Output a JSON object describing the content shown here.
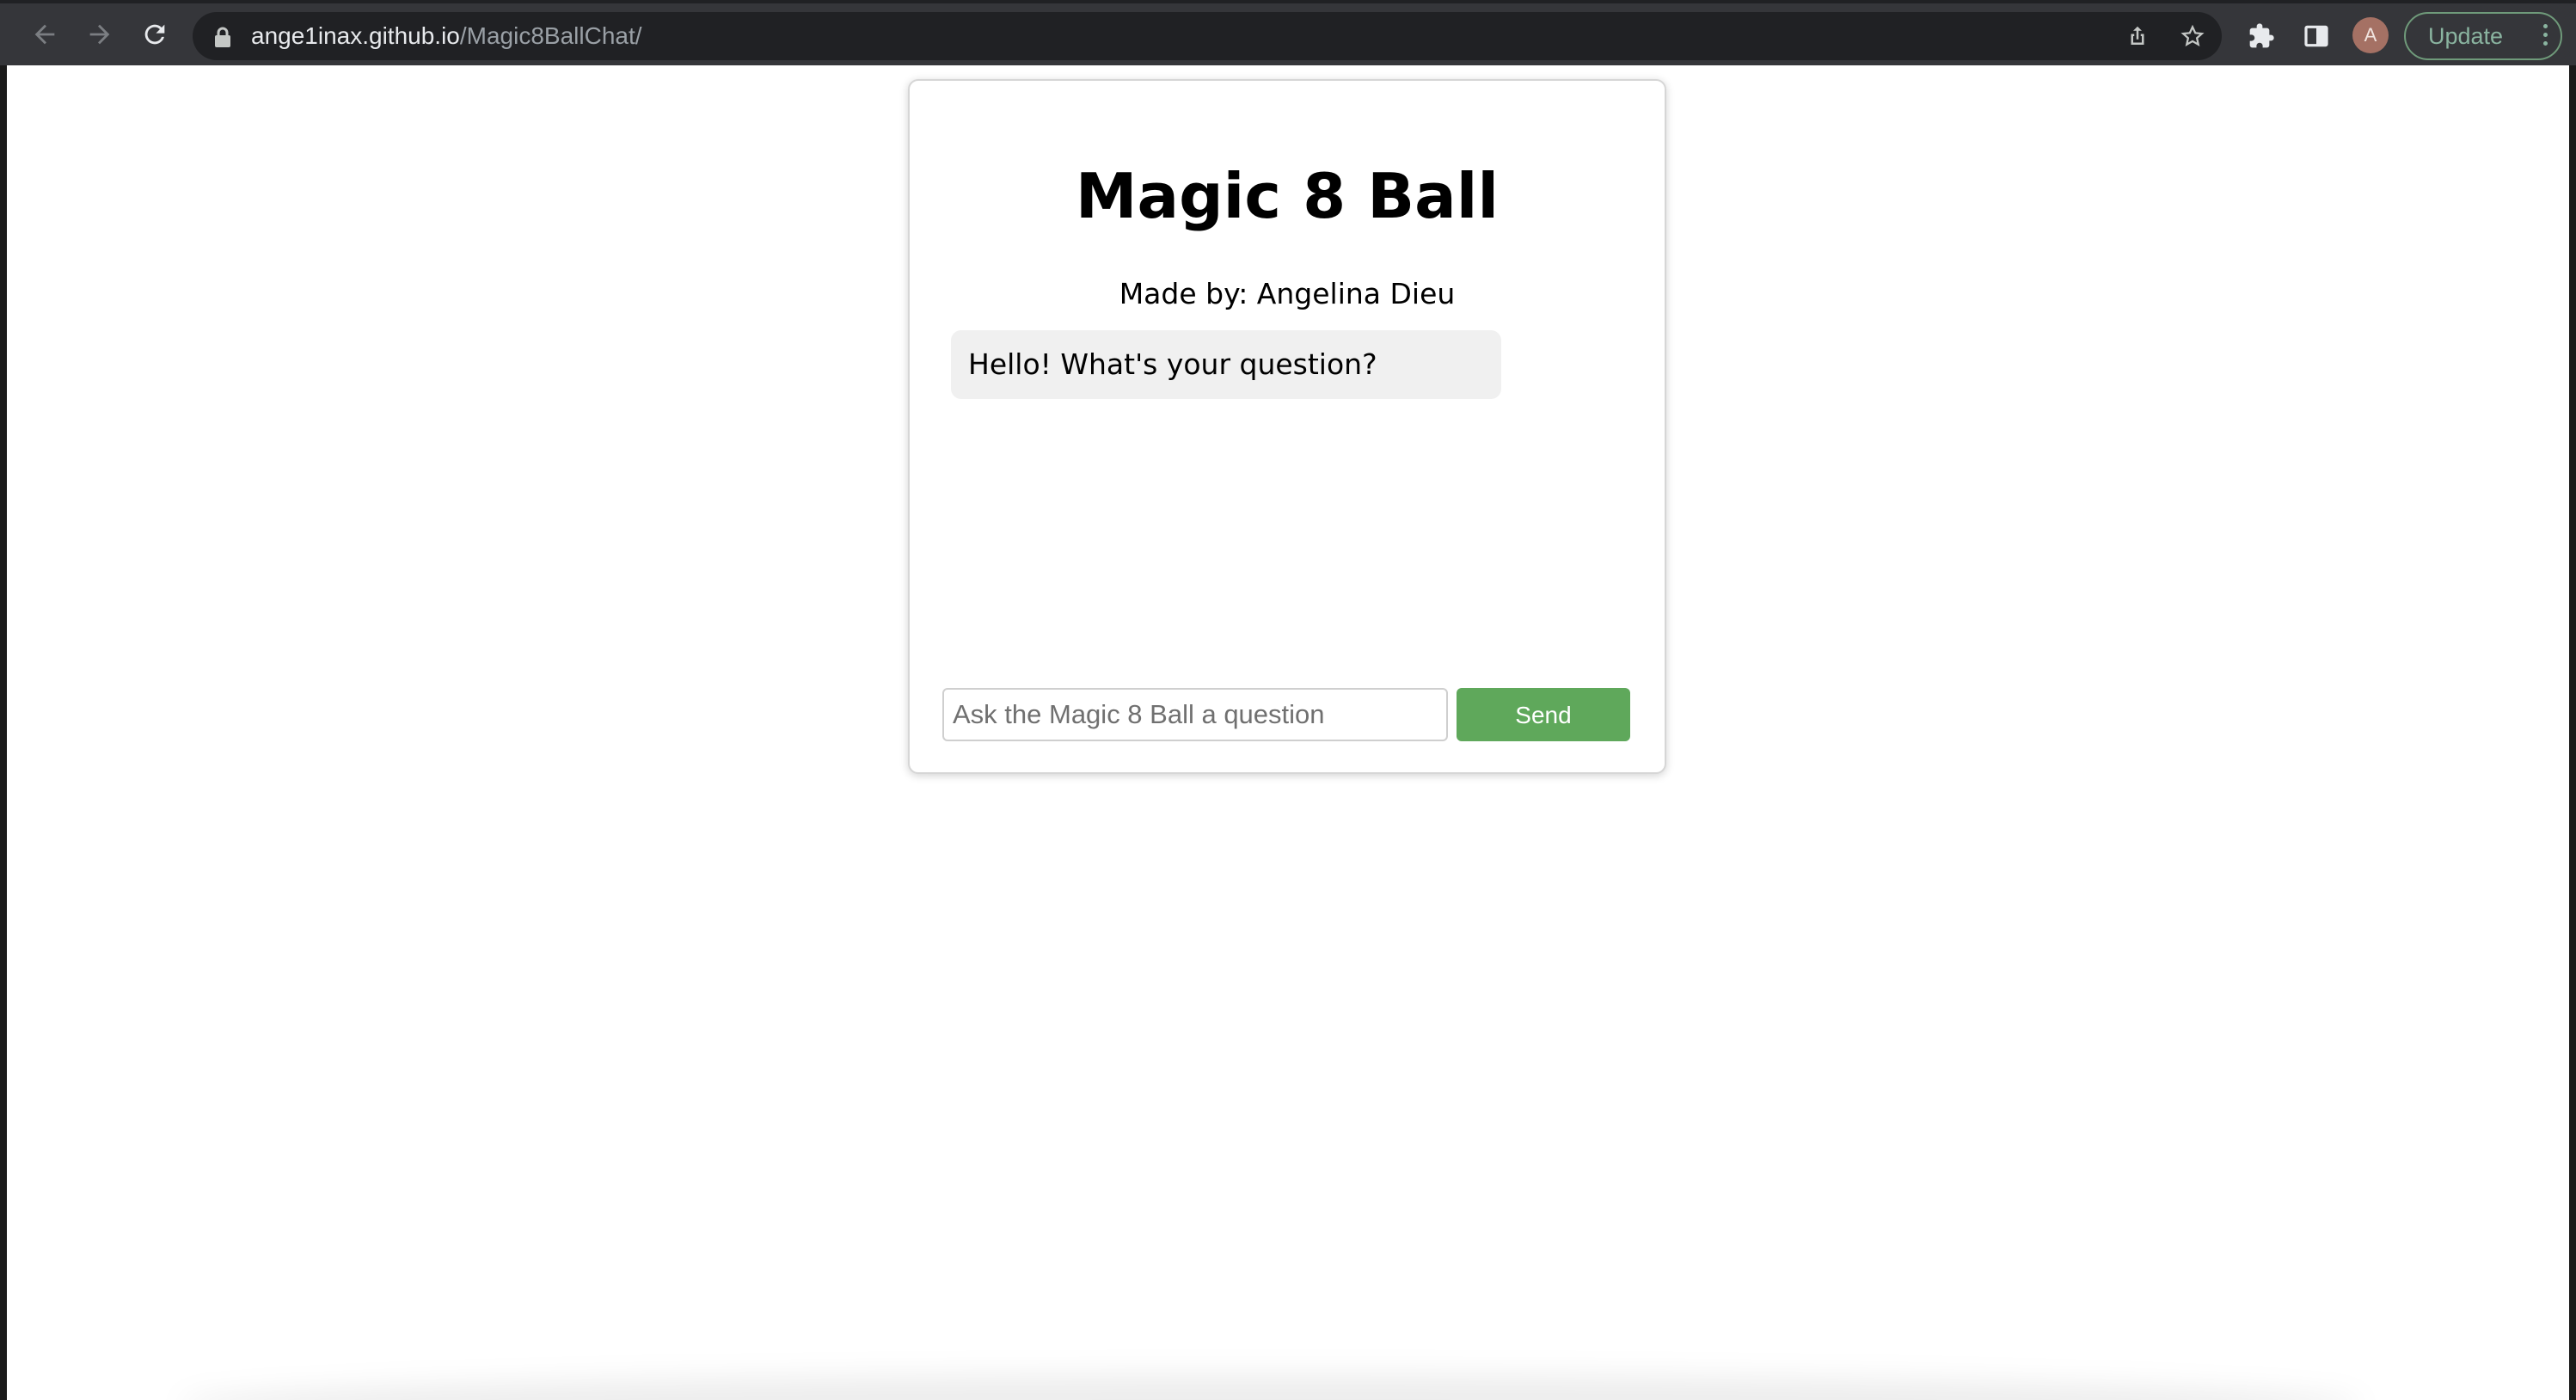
{
  "browser": {
    "url_host": "ange1inax.github.io",
    "url_path": "/Magic8BallChat/",
    "profile_initial": "A",
    "update_label": "Update",
    "icons": [
      "back-arrow-icon",
      "forward-arrow-icon",
      "reload-icon",
      "lock-icon",
      "share-icon",
      "star-icon",
      "extensions-icon",
      "side-panel-icon",
      "menu-dots-icon"
    ]
  },
  "page": {
    "title": "Magic 8 Ball",
    "subtitle": "Made by: Angelina Dieu",
    "messages": [
      {
        "text": "Hello! What's your question?"
      }
    ],
    "input_placeholder": "Ask the Magic 8 Ball a question",
    "input_value": "",
    "send_label": "Send",
    "colors": {
      "send_button": "#5fa85b",
      "bubble": "#f0f0f0"
    }
  }
}
